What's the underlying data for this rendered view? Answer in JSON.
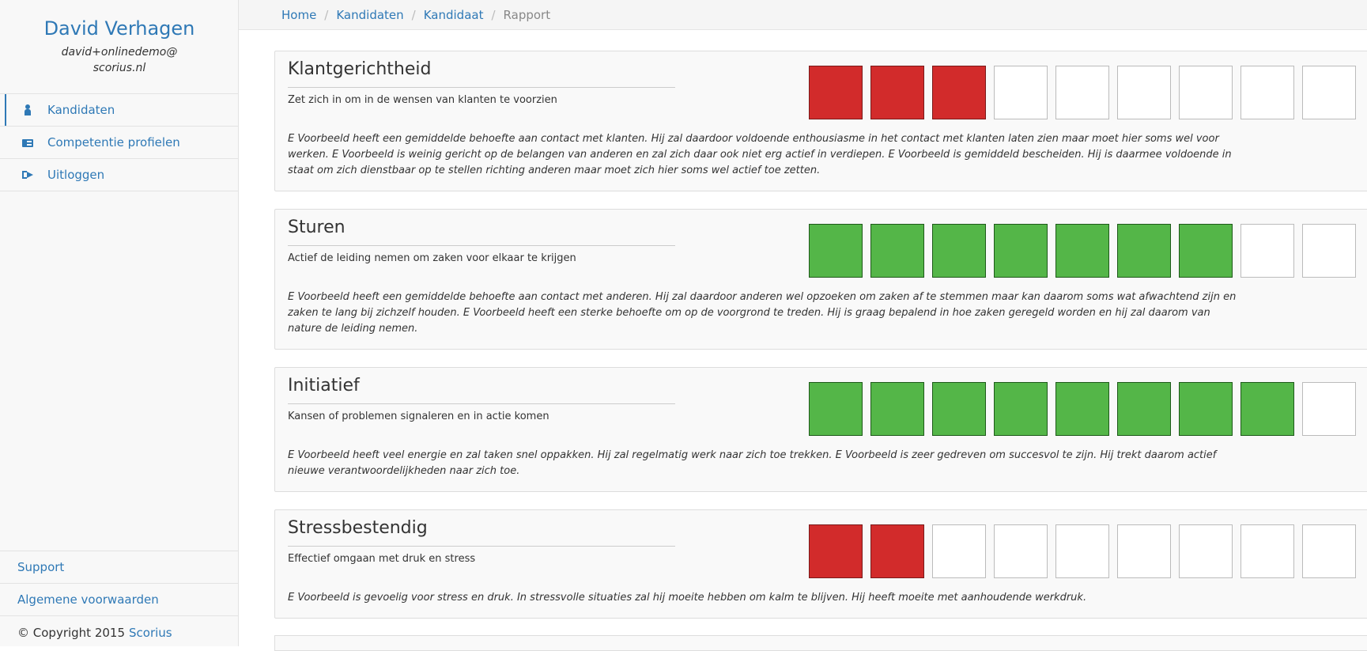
{
  "sidebar": {
    "user_name": "David Verhagen",
    "email_line1": "david+onlinedemo@",
    "email_line2": "scorius.nl",
    "nav": [
      {
        "label": "Kandidaten",
        "icon": "person-icon",
        "active": true
      },
      {
        "label": "Competentie profielen",
        "icon": "card-icon",
        "active": false
      },
      {
        "label": "Uitloggen",
        "icon": "logout-icon",
        "active": false
      }
    ],
    "footer": {
      "support": "Support",
      "terms": "Algemene voorwaarden",
      "copyright": "© Copyright 2015",
      "brand": "Scorius"
    }
  },
  "breadcrumb": {
    "home": "Home",
    "candidates": "Kandidaten",
    "candidate": "Kandidaat",
    "current": "Rapport",
    "separator": "/"
  },
  "colors": {
    "accent": "#2f79b6",
    "low_score": "#d22b2b",
    "high_score": "#54b648"
  },
  "competencies": [
    {
      "title": "Klantgerichtheid",
      "subtitle": "Zet zich in om in de wensen van klanten te voorzien",
      "score": 3,
      "max": 9,
      "color": "red",
      "description": "E Voorbeeld heeft een gemiddelde behoefte aan contact met klanten. Hij zal daardoor voldoende enthousiasme in het contact met klanten laten zien maar moet hier soms wel voor werken. E Voorbeeld is weinig gericht op de belangen van anderen en zal zich daar ook niet erg actief in verdiepen. E Voorbeeld is gemiddeld bescheiden. Hij is daarmee voldoende in staat om zich dienstbaar op te stellen richting anderen maar moet zich hier soms wel actief toe zetten."
    },
    {
      "title": "Sturen",
      "subtitle": "Actief de leiding nemen om zaken voor elkaar te krijgen",
      "score": 7,
      "max": 9,
      "color": "green",
      "description": "E Voorbeeld heeft een gemiddelde behoefte aan contact met anderen. Hij zal daardoor anderen wel opzoeken om zaken af te stemmen maar kan daarom soms wat afwachtend zijn en zaken te lang bij zichzelf houden. E Voorbeeld heeft een sterke behoefte om op de voorgrond te treden. Hij is graag bepalend in hoe zaken geregeld worden en hij zal daarom van nature de leiding nemen."
    },
    {
      "title": "Initiatief",
      "subtitle": "Kansen of problemen signaleren en in actie komen",
      "score": 8,
      "max": 9,
      "color": "green",
      "description": "E Voorbeeld heeft veel energie en zal taken snel oppakken. Hij zal regelmatig werk naar zich toe trekken. E Voorbeeld is zeer gedreven om succesvol te zijn. Hij trekt daarom actief nieuwe verantwoordelijkheden naar zich toe."
    },
    {
      "title": "Stressbestendig",
      "subtitle": "Effectief omgaan met druk en stress",
      "score": 2,
      "max": 9,
      "color": "red",
      "description": "E Voorbeeld is gevoelig voor stress en druk. In stressvolle situaties zal hij moeite hebben om kalm te blijven. Hij heeft moeite met aanhoudende werkdruk."
    }
  ]
}
